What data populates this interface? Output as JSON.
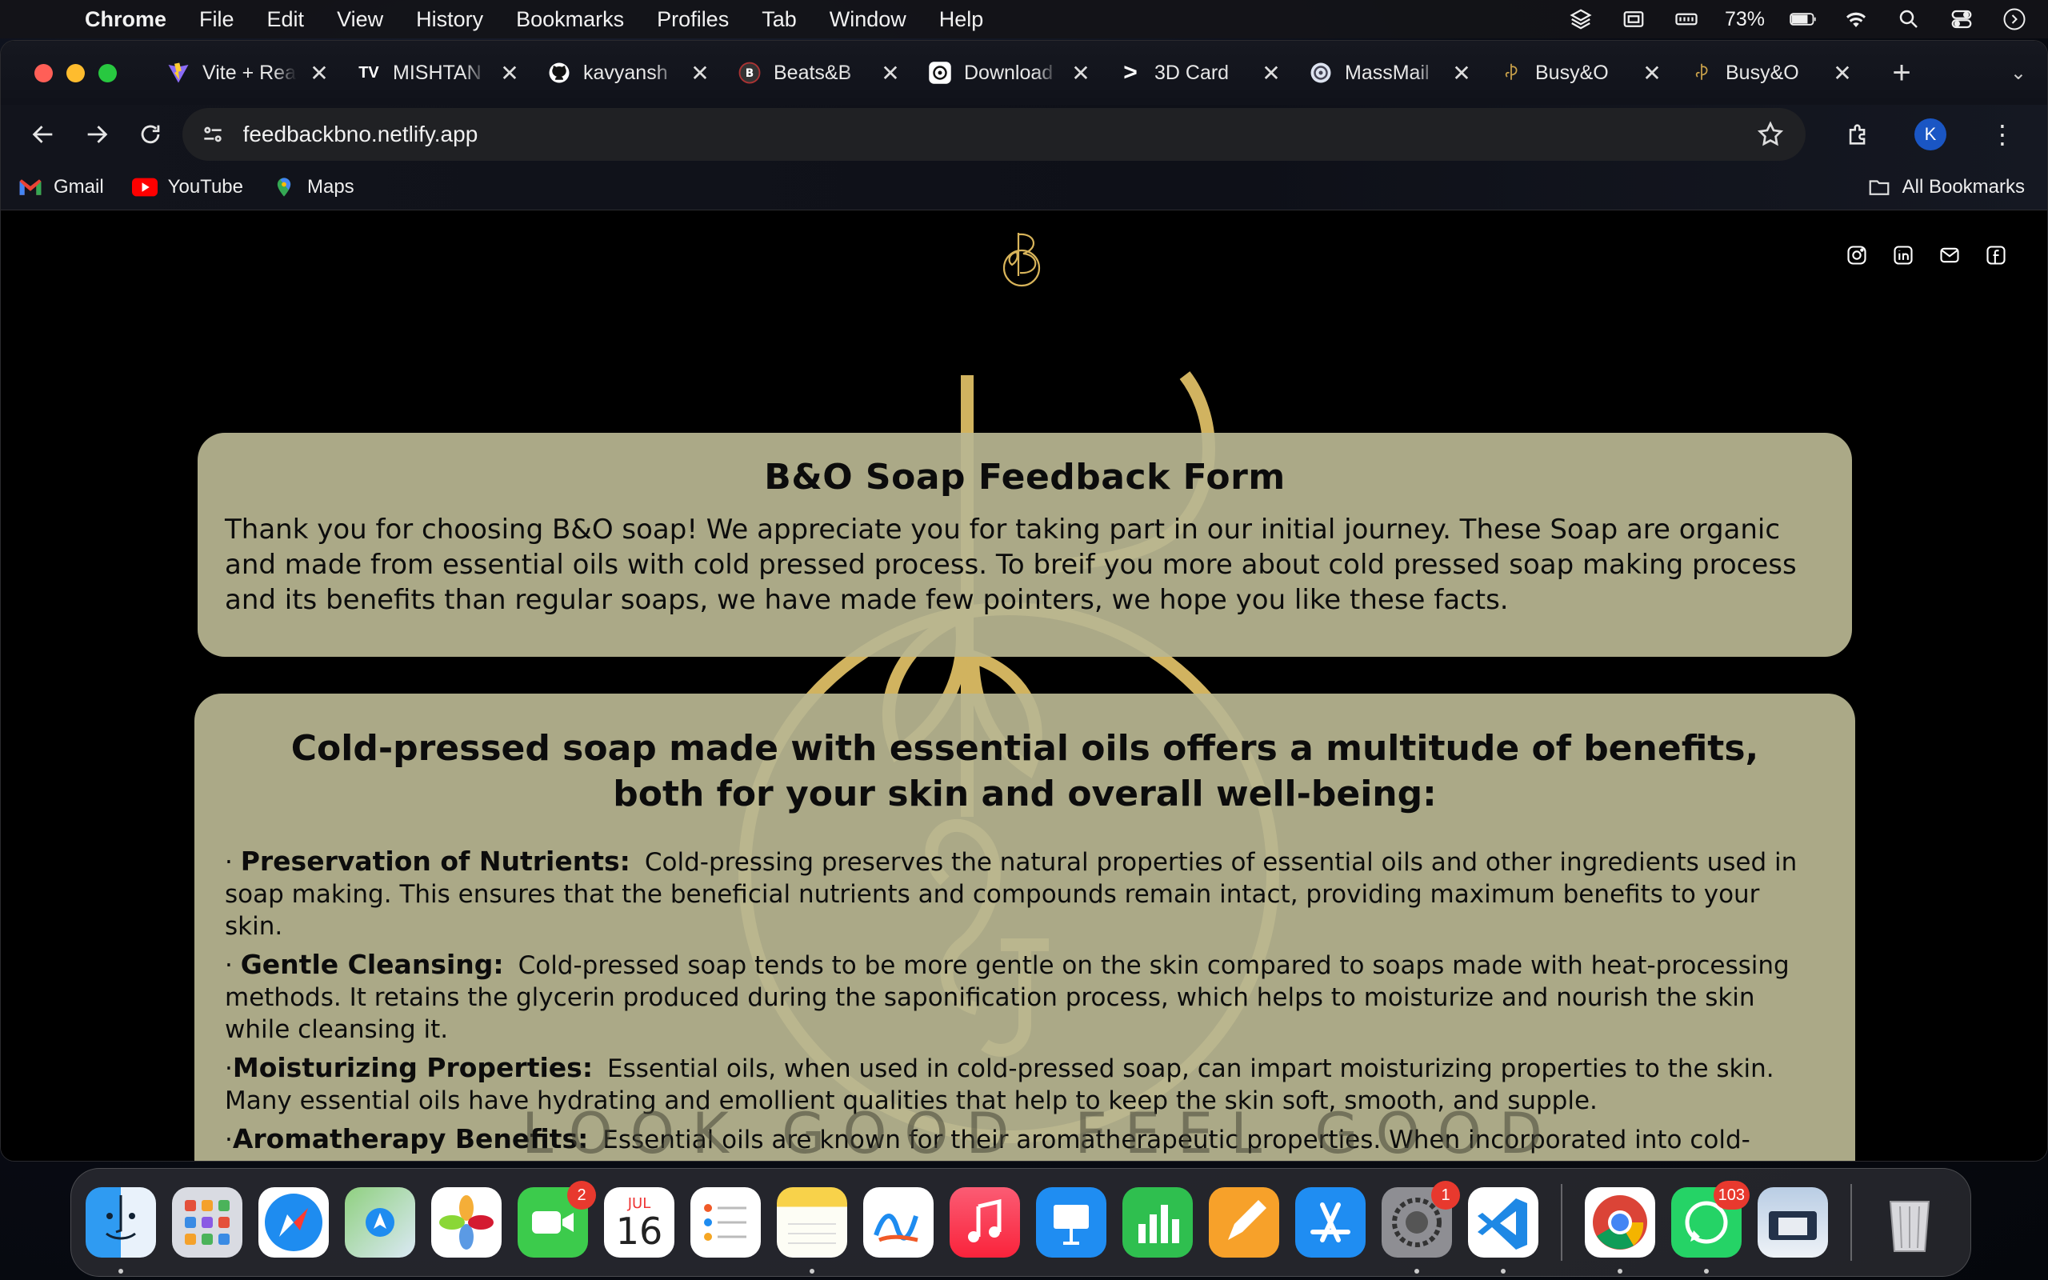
{
  "menubar": {
    "app": "Chrome",
    "items": [
      "File",
      "Edit",
      "View",
      "History",
      "Bookmarks",
      "Profiles",
      "Tab",
      "Window",
      "Help"
    ],
    "battery": "73%"
  },
  "tabs": [
    {
      "title": "Vite + React",
      "icon": "vite-icon"
    },
    {
      "title": "MISHTAN",
      "icon": "tradingview-icon"
    },
    {
      "title": "kavyansh",
      "icon": "github-icon"
    },
    {
      "title": "Beats&B",
      "icon": "beats-icon"
    },
    {
      "title": "Download",
      "icon": "openai-icon"
    },
    {
      "title": "3D Card",
      "icon": "terminal-icon"
    },
    {
      "title": "MassMail",
      "icon": "massmail-icon"
    },
    {
      "title": "Busy&O",
      "icon": "bo-leaf-icon"
    },
    {
      "title": "Busy&O",
      "icon": "bo-leaf-icon"
    }
  ],
  "address": {
    "url": "feedbackbno.netlify.app"
  },
  "profile": {
    "initial": "K"
  },
  "bookmarks": {
    "items": [
      {
        "label": "Gmail",
        "icon": "gmail-icon"
      },
      {
        "label": "YouTube",
        "icon": "youtube-icon"
      },
      {
        "label": "Maps",
        "icon": "maps-icon"
      }
    ],
    "all_label": "All Bookmarks"
  },
  "page": {
    "form_title": "B&O Soap Feedback Form",
    "intro": "Thank you for choosing B&O soap! We appreciate you for taking part in our initial journey. These Soap are organic and made from essential oils with cold pressed process. To breif you more about cold pressed soap making process and its benefits than regular soaps, we have made few pointers, we hope you like these facts.",
    "benefits_heading": "Cold-pressed soap made with essential oils offers a multitude of benefits, both for your skin and overall well-being:",
    "points": [
      {
        "bullet": "· ",
        "title": "Preservation of Nutrients:",
        "text": "Cold-pressing preserves the natural properties of essential oils and other ingredients used in soap making. This ensures that the beneficial nutrients and compounds remain intact, providing maximum benefits to your skin."
      },
      {
        "bullet": "· ",
        "title": "Gentle Cleansing:",
        "text": "Cold-pressed soap tends to be more gentle on the skin compared to soaps made with heat-processing methods. It retains the glycerin produced during the saponification process, which helps to moisturize and nourish the skin while cleansing it."
      },
      {
        "bullet": "·",
        "title": "Moisturizing Properties:",
        "text": "Essential oils, when used in cold-pressed soap, can impart moisturizing properties to the skin. Many essential oils have hydrating and emollient qualities that help to keep the skin soft, smooth, and supple."
      },
      {
        "bullet": "·",
        "title": "Aromatherapy Benefits:",
        "text": "Essential oils are known for their aromatherapeutic properties. When incorporated into cold-pressed soap, they can provide various benefits such as stress relief, relaxation, invigoration, or mood enhancement depending on the specific oils used."
      }
    ],
    "tagline_left": "LOOK GOOD",
    "tagline_right": "FEEL GOOD"
  },
  "dock": {
    "calendar_month": "JUL",
    "calendar_day": "16",
    "facetime_badge": "2",
    "settings_badge": "1",
    "whatsapp_badge": "103"
  },
  "colors": {
    "card_bg": "#b8b691",
    "gold": "#e8c76a",
    "omnibox": "#202124"
  }
}
